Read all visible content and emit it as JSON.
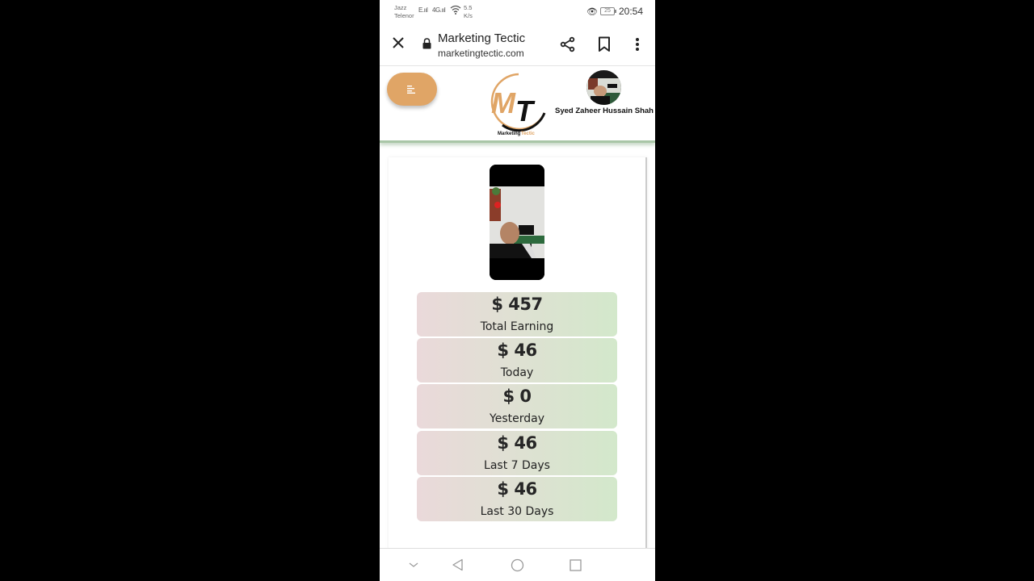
{
  "status_bar": {
    "carrier_line1": "Jazz",
    "carrier_line2": "Telenor",
    "signal1_label": "E",
    "signal2_label": "4G",
    "net_speed_value": "5.5",
    "net_speed_unit": "K/s",
    "battery_level": "25",
    "time": "20:54"
  },
  "browser": {
    "title": "Marketing Tectic",
    "url": "marketingtectic.com",
    "icons": [
      "close-icon",
      "lock-icon",
      "share-icon",
      "bookmark-icon",
      "more-vert-icon"
    ]
  },
  "header": {
    "menu_icon": "menu-icon",
    "logo_letters": "MT",
    "logo_caption_part1": "Marketing",
    "logo_caption_part2": "Tectic",
    "user_name": "Syed Zaheer Hussain Shah",
    "brand_color": "#e0a566"
  },
  "stats": [
    {
      "value": "$ 457",
      "label": "Total Earning"
    },
    {
      "value": "$ 46",
      "label": "Today"
    },
    {
      "value": "$ 0",
      "label": "Yesterday"
    },
    {
      "value": "$ 46",
      "label": "Last 7 Days"
    },
    {
      "value": "$ 46",
      "label": "Last 30 Days"
    }
  ],
  "nav": {
    "icons": [
      "hide-keyboard-icon",
      "back-icon",
      "home-icon",
      "recents-icon"
    ]
  }
}
